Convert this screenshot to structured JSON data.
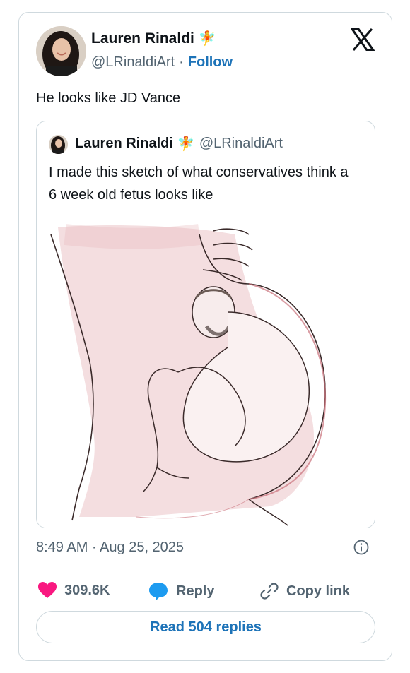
{
  "tweet": {
    "author_name": "Lauren Rinaldi",
    "author_emoji": "🧚",
    "handle": "@LRinaldiArt",
    "separator": "·",
    "follow_label": "Follow",
    "text": "He looks like JD Vance",
    "timestamp": "8:49 AM · Aug 25, 2025"
  },
  "quoted": {
    "author_name": "Lauren Rinaldi",
    "author_emoji": "🧚",
    "handle": "@LRinaldiArt",
    "text": "I made this sketch of what conservatives think a 6 week old fetus looks like"
  },
  "actions": {
    "likes": "309.6K",
    "reply_label": "Reply",
    "copy_label": "Copy link",
    "read_replies_label": "Read 504 replies"
  },
  "colors": {
    "link": "#1d73b8",
    "heart": "#f91880",
    "reply_bubble": "#1d9bf0",
    "secondary_text": "#536471",
    "border": "#cfd9de"
  },
  "icons": [
    "x-logo-icon",
    "info-icon",
    "heart-icon",
    "reply-bubble-icon",
    "link-icon"
  ]
}
